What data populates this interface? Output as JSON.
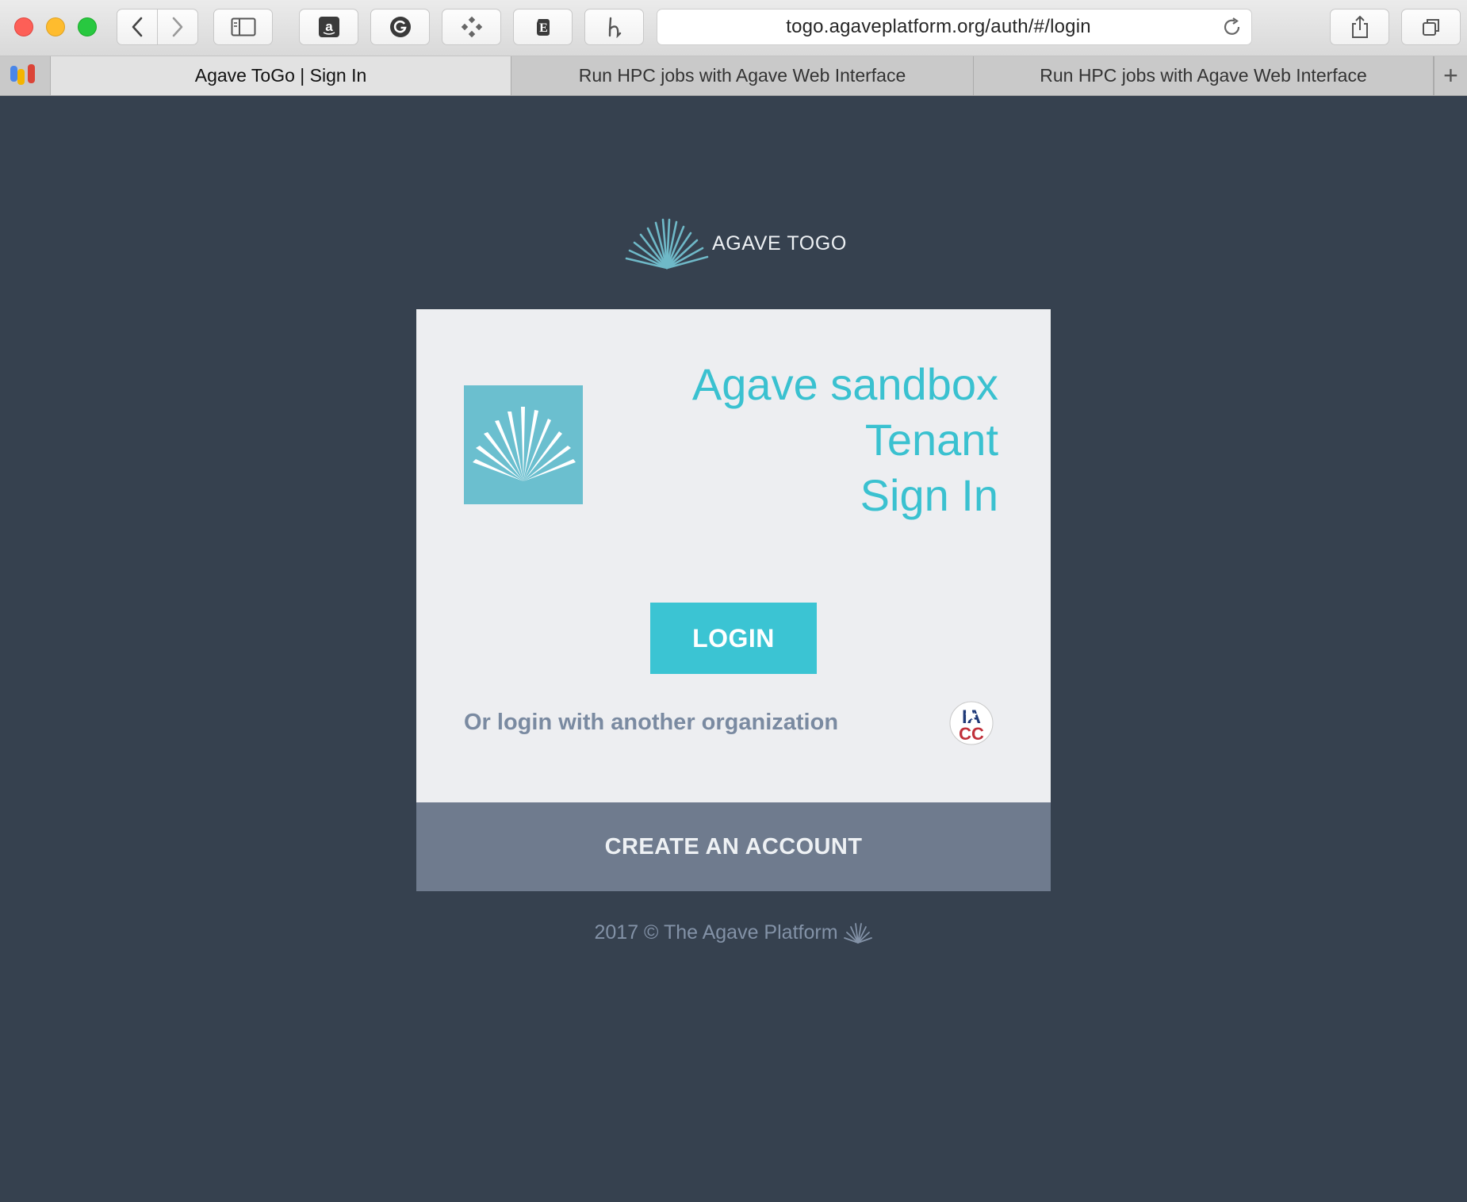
{
  "browser": {
    "url": "togo.agaveplatform.org/auth/#/login",
    "toolbar_icons": [
      "back-icon",
      "forward-icon",
      "sidebar-icon",
      "amazon-icon",
      "grammarly-icon",
      "extension-icon",
      "evernote-icon",
      "honey-icon",
      "share-icon",
      "tabs-overview-icon"
    ],
    "tabs": [
      {
        "label": "Agave ToGo | Sign In",
        "active": true
      },
      {
        "label": "Run HPC jobs with Agave Web Interface",
        "active": false
      },
      {
        "label": "Run HPC jobs with Agave Web Interface",
        "active": false
      }
    ],
    "new_tab_label": "+"
  },
  "header": {
    "brand_text": "AGAVE TOGO"
  },
  "card": {
    "title_lines": [
      "Agave sandbox",
      "Tenant",
      "Sign In"
    ],
    "login_label": "LOGIN",
    "other_org_label": "Or login with another organization",
    "create_account_label": "CREATE AN ACCOUNT"
  },
  "footer": {
    "text": "2017 © The Agave Platform"
  },
  "colors": {
    "page_bg": "#36414f",
    "card_bg": "#edeef1",
    "accent": "#3bc4d3",
    "create_bar": "#6f7b8e",
    "muted_text": "#7a8aa1"
  }
}
